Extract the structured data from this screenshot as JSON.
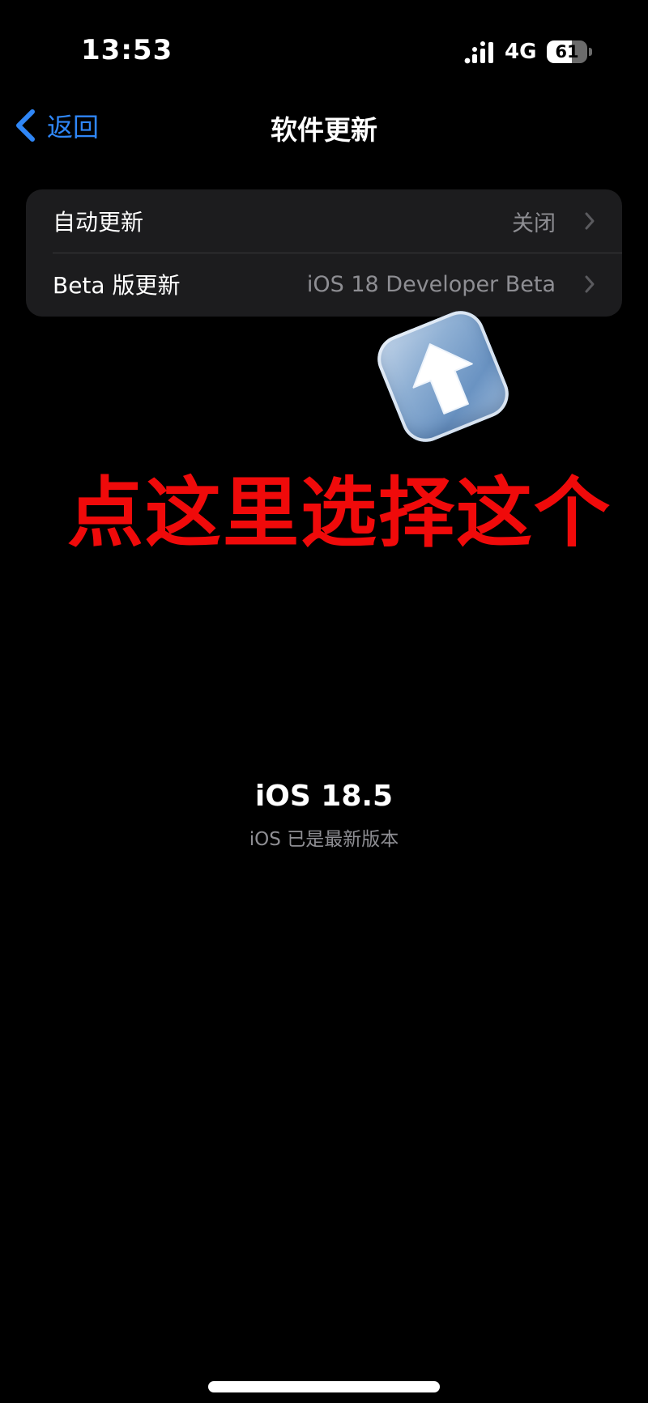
{
  "status_bar": {
    "time": "13:53",
    "network": "4G",
    "battery_level": "61",
    "battery_fraction": 0.61
  },
  "nav": {
    "back_label": "返回",
    "title": "软件更新"
  },
  "settings": {
    "rows": [
      {
        "label": "自动更新",
        "value": "关闭"
      },
      {
        "label": "Beta 版更新",
        "value": "iOS 18 Developer Beta"
      }
    ]
  },
  "annotation": {
    "text": "点这里选择这个",
    "color": "#f00a0a",
    "icon": "up-arrow-icon"
  },
  "software": {
    "version": "iOS 18.5",
    "status": "iOS 已是最新版本"
  },
  "colors": {
    "accent": "#2f86f6",
    "background": "#000000",
    "group_background": "#1c1c1e",
    "secondary_text": "#8e8e93"
  }
}
